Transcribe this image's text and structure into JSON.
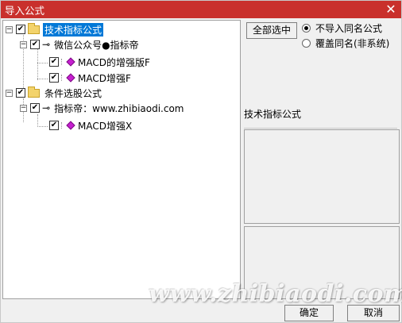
{
  "window": {
    "title": "导入公式",
    "close_glyph": "✕"
  },
  "tree": {
    "nodes": [
      {
        "label": "技术指标公式",
        "type": "folder",
        "checked": true,
        "selected": true,
        "expander": "−"
      },
      {
        "label": "微信公众号●指标帝",
        "type": "author",
        "checked": true,
        "expander": "−"
      },
      {
        "label": "MACD的增强版F",
        "type": "formula",
        "checked": true
      },
      {
        "label": "MACD增强F",
        "type": "formula",
        "checked": true
      },
      {
        "label": "条件选股公式",
        "type": "folder",
        "checked": true,
        "expander": "−"
      },
      {
        "label": "指标帝：www.zhibiaodi.com",
        "type": "author",
        "checked": true,
        "expander": "−"
      },
      {
        "label": "MACD增强X",
        "type": "formula",
        "checked": true
      }
    ],
    "check_glyph": "✔"
  },
  "options": {
    "select_all_label": "全部选中",
    "radio_no_import_label": "不导入同名公式",
    "radio_overwrite_label": "覆盖同名(非系统)",
    "selected_radio": "no_import"
  },
  "detail": {
    "category_label": "技术指标公式"
  },
  "buttons": {
    "ok_label": "确定",
    "cancel_label": "取消"
  },
  "watermark": {
    "text": "www.zhibiaodi.com"
  },
  "colors": {
    "titlebar": "#c9302c",
    "selection": "#0078d7",
    "formula_icon": "#c61fd0",
    "folder": "#f3d36b"
  }
}
